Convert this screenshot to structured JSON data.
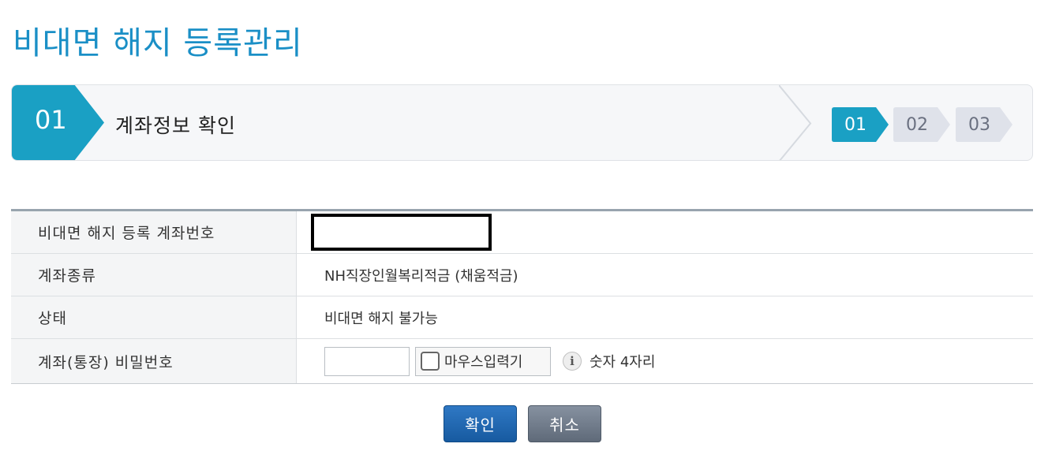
{
  "page": {
    "title": "비대면 해지 등록관리"
  },
  "step": {
    "current_number": "01",
    "current_name": "계좌정보 확인",
    "indicators": [
      "01",
      "02",
      "03"
    ],
    "active_color": "#1aa0c4",
    "inactive_color": "#dfe2ea"
  },
  "form": {
    "rows": [
      {
        "label": "비대면 해지 등록 계좌번호",
        "value": ""
      },
      {
        "label": "계좌종류",
        "value": "NH직장인월복리적금 (채움적금)"
      },
      {
        "label": "상태",
        "value": "비대면 해지 불가능"
      },
      {
        "label": "계좌(통장) 비밀번호",
        "value": ""
      }
    ],
    "password": {
      "value": "",
      "mouse_input_label": "마우스입력기",
      "info_icon": "info-icon",
      "hint": "숫자 4자리"
    }
  },
  "buttons": {
    "ok": "확인",
    "cancel": "취소"
  }
}
